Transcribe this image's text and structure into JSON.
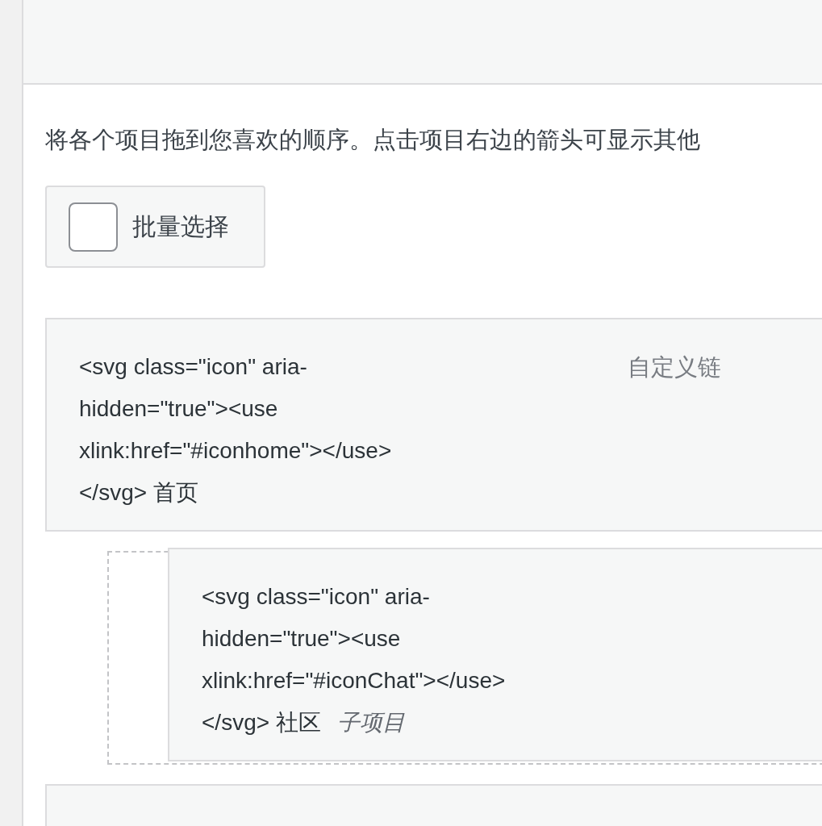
{
  "intro": "将各个项目拖到您喜欢的顺序。点击项目右边的箭头可显示其他",
  "bulk_select": {
    "label": "批量选择",
    "checked": false
  },
  "menu_items": [
    {
      "title": "<svg class=\"icon\" aria-hidden=\"true\"><use xlink:href=\"#iconhome\"></use></svg> 首页",
      "type_label": "自定义链",
      "children": [
        {
          "title": "<svg class=\"icon\" aria-hidden=\"true\"><use xlink:href=\"#iconChat\"></use></svg> 社区",
          "sub_label": "子项目"
        }
      ]
    }
  ],
  "more_items_below": true
}
